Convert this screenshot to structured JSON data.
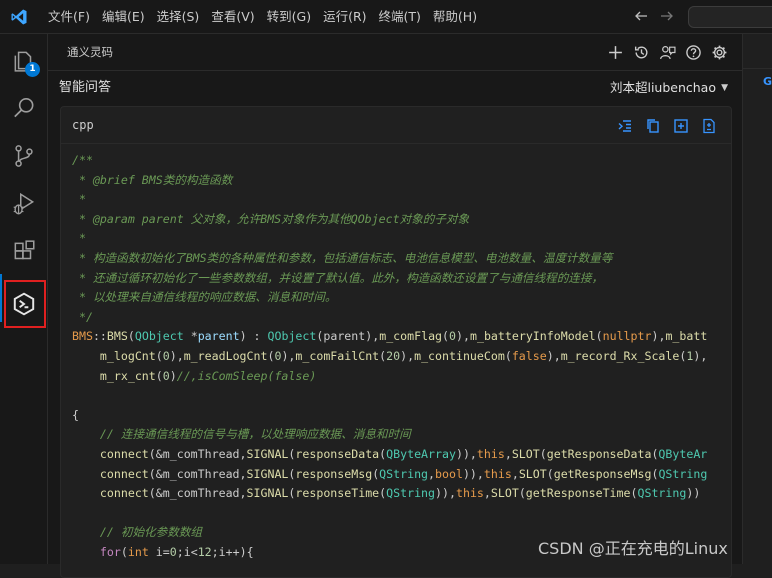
{
  "menu": [
    "文件(F)",
    "编辑(E)",
    "选择(S)",
    "查看(V)",
    "转到(G)",
    "运行(R)",
    "终端(T)",
    "帮助(H)"
  ],
  "activity": {
    "explorer_badge": "1"
  },
  "panel": {
    "title": "通义灵码",
    "subtitle": "智能问答",
    "user_name": "刘本超liubenchao",
    "user_caret": "▼"
  },
  "code_block": {
    "language": "cpp",
    "lines": [
      [
        {
          "t": "/**",
          "c": "c"
        }
      ],
      [
        {
          "t": " * @brief BMS类的构造函数",
          "c": "c"
        }
      ],
      [
        {
          "t": " *",
          "c": "c"
        }
      ],
      [
        {
          "t": " * @param parent 父对象，允许BMS对象作为其他QObject对象的子对象",
          "c": "c"
        }
      ],
      [
        {
          "t": " *",
          "c": "c"
        }
      ],
      [
        {
          "t": " * 构造函数初始化了BMS类的各种属性和参数，包括通信标志、电池信息模型、电池数量、温度计数量等",
          "c": "c"
        }
      ],
      [
        {
          "t": " * 还通过循环初始化了一些参数数组，并设置了默认值。此外，构造函数还设置了与通信线程的连接，",
          "c": "c"
        }
      ],
      [
        {
          "t": " * 以处理来自通信线程的响应数据、消息和时间。",
          "c": "c"
        }
      ],
      [
        {
          "t": " */",
          "c": "c"
        }
      ],
      [
        {
          "t": "BMS",
          "c": "o"
        },
        {
          "t": "::",
          "c": "d"
        },
        {
          "t": "BMS",
          "c": "f"
        },
        {
          "t": "(",
          "c": "d"
        },
        {
          "t": "QObject",
          "c": "t"
        },
        {
          "t": " *",
          "c": "d"
        },
        {
          "t": "parent",
          "c": "v"
        },
        {
          "t": ") : ",
          "c": "d"
        },
        {
          "t": "QObject",
          "c": "t"
        },
        {
          "t": "(parent),",
          "c": "d"
        },
        {
          "t": "m_comFlag",
          "c": "f"
        },
        {
          "t": "(",
          "c": "d"
        },
        {
          "t": "0",
          "c": "n"
        },
        {
          "t": "),",
          "c": "d"
        },
        {
          "t": "m_batteryInfoModel",
          "c": "f"
        },
        {
          "t": "(",
          "c": "d"
        },
        {
          "t": "nullptr",
          "c": "o"
        },
        {
          "t": "),",
          "c": "d"
        },
        {
          "t": "m_batt",
          "c": "f"
        }
      ],
      [
        {
          "t": "    ",
          "c": "d"
        },
        {
          "t": "m_logCnt",
          "c": "f"
        },
        {
          "t": "(",
          "c": "d"
        },
        {
          "t": "0",
          "c": "n"
        },
        {
          "t": "),",
          "c": "d"
        },
        {
          "t": "m_readLogCnt",
          "c": "f"
        },
        {
          "t": "(",
          "c": "d"
        },
        {
          "t": "0",
          "c": "n"
        },
        {
          "t": "),",
          "c": "d"
        },
        {
          "t": "m_comFailCnt",
          "c": "f"
        },
        {
          "t": "(",
          "c": "d"
        },
        {
          "t": "20",
          "c": "n"
        },
        {
          "t": "),",
          "c": "d"
        },
        {
          "t": "m_continueCom",
          "c": "f"
        },
        {
          "t": "(",
          "c": "d"
        },
        {
          "t": "false",
          "c": "o"
        },
        {
          "t": "),",
          "c": "d"
        },
        {
          "t": "m_record_Rx_Scale",
          "c": "f"
        },
        {
          "t": "(",
          "c": "d"
        },
        {
          "t": "1",
          "c": "n"
        },
        {
          "t": "),",
          "c": "d"
        }
      ],
      [
        {
          "t": "    ",
          "c": "d"
        },
        {
          "t": "m_rx_cnt",
          "c": "f"
        },
        {
          "t": "(",
          "c": "d"
        },
        {
          "t": "0",
          "c": "n"
        },
        {
          "t": ")",
          "c": "d"
        },
        {
          "t": "//,isComSleep(false)",
          "c": "c"
        }
      ],
      [
        {
          "t": "",
          "c": "d"
        }
      ],
      [
        {
          "t": "{",
          "c": "d"
        }
      ],
      [
        {
          "t": "    ",
          "c": "d"
        },
        {
          "t": "// 连接通信线程的信号与槽，以处理响应数据、消息和时间",
          "c": "c"
        }
      ],
      [
        {
          "t": "    ",
          "c": "d"
        },
        {
          "t": "connect",
          "c": "f"
        },
        {
          "t": "(&m_comThread,",
          "c": "d"
        },
        {
          "t": "SIGNAL",
          "c": "f"
        },
        {
          "t": "(",
          "c": "d"
        },
        {
          "t": "responseData",
          "c": "f"
        },
        {
          "t": "(",
          "c": "d"
        },
        {
          "t": "QByteArray",
          "c": "t"
        },
        {
          "t": ")),",
          "c": "d"
        },
        {
          "t": "this",
          "c": "o"
        },
        {
          "t": ",",
          "c": "d"
        },
        {
          "t": "SLOT",
          "c": "f"
        },
        {
          "t": "(",
          "c": "d"
        },
        {
          "t": "getResponseData",
          "c": "f"
        },
        {
          "t": "(",
          "c": "d"
        },
        {
          "t": "QByteAr",
          "c": "t"
        }
      ],
      [
        {
          "t": "    ",
          "c": "d"
        },
        {
          "t": "connect",
          "c": "f"
        },
        {
          "t": "(&m_comThread,",
          "c": "d"
        },
        {
          "t": "SIGNAL",
          "c": "f"
        },
        {
          "t": "(",
          "c": "d"
        },
        {
          "t": "responseMsg",
          "c": "f"
        },
        {
          "t": "(",
          "c": "d"
        },
        {
          "t": "QString",
          "c": "t"
        },
        {
          "t": ",",
          "c": "d"
        },
        {
          "t": "bool",
          "c": "o"
        },
        {
          "t": ")),",
          "c": "d"
        },
        {
          "t": "this",
          "c": "o"
        },
        {
          "t": ",",
          "c": "d"
        },
        {
          "t": "SLOT",
          "c": "f"
        },
        {
          "t": "(",
          "c": "d"
        },
        {
          "t": "getResponseMsg",
          "c": "f"
        },
        {
          "t": "(",
          "c": "d"
        },
        {
          "t": "QString",
          "c": "t"
        }
      ],
      [
        {
          "t": "    ",
          "c": "d"
        },
        {
          "t": "connect",
          "c": "f"
        },
        {
          "t": "(&m_comThread,",
          "c": "d"
        },
        {
          "t": "SIGNAL",
          "c": "f"
        },
        {
          "t": "(",
          "c": "d"
        },
        {
          "t": "responseTime",
          "c": "f"
        },
        {
          "t": "(",
          "c": "d"
        },
        {
          "t": "QString",
          "c": "t"
        },
        {
          "t": ")),",
          "c": "d"
        },
        {
          "t": "this",
          "c": "o"
        },
        {
          "t": ",",
          "c": "d"
        },
        {
          "t": "SLOT",
          "c": "f"
        },
        {
          "t": "(",
          "c": "d"
        },
        {
          "t": "getResponseTime",
          "c": "f"
        },
        {
          "t": "(",
          "c": "d"
        },
        {
          "t": "QString",
          "c": "t"
        },
        {
          "t": "))",
          "c": "d"
        }
      ],
      [
        {
          "t": "",
          "c": "d"
        }
      ],
      [
        {
          "t": "    ",
          "c": "d"
        },
        {
          "t": "// 初始化参数数组",
          "c": "c"
        }
      ],
      [
        {
          "t": "    ",
          "c": "d"
        },
        {
          "t": "for",
          "c": "k"
        },
        {
          "t": "(",
          "c": "d"
        },
        {
          "t": "int",
          "c": "o"
        },
        {
          "t": " i=",
          "c": "d"
        },
        {
          "t": "0",
          "c": "n"
        },
        {
          "t": ";i<",
          "c": "d"
        },
        {
          "t": "12",
          "c": "n"
        },
        {
          "t": ";i++){",
          "c": "d"
        }
      ]
    ]
  },
  "right_strip": {
    "glyph": "G"
  },
  "watermark": "CSDN @正在充电的Linux"
}
